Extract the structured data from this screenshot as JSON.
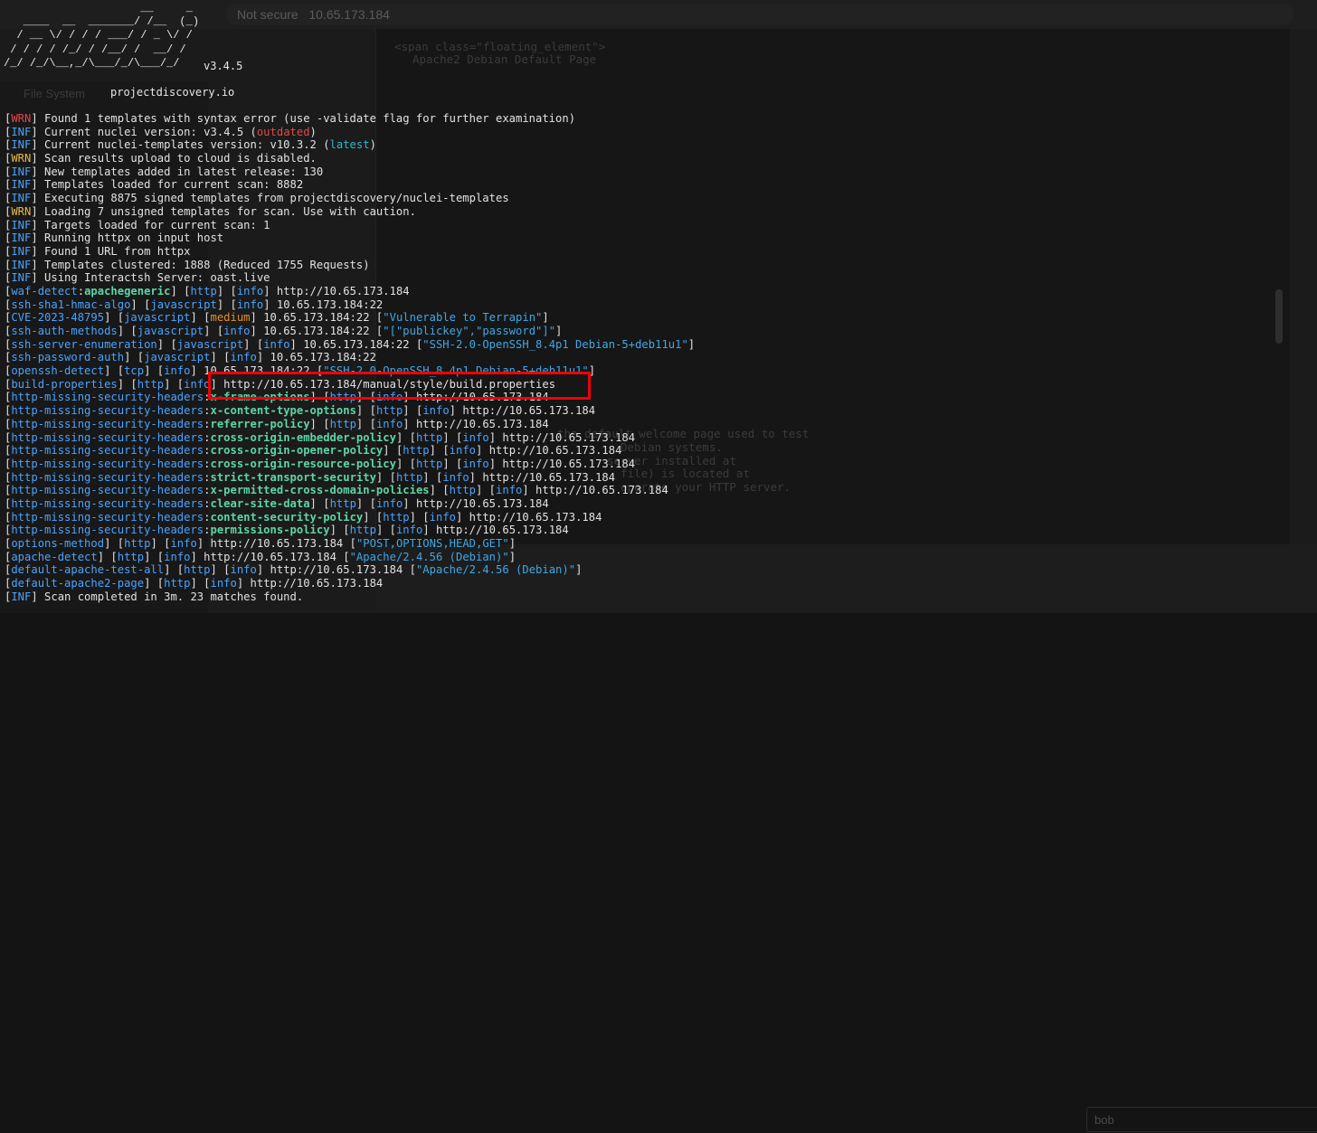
{
  "background": {
    "url_text": "Not secure",
    "url_host": "10.65.173.184",
    "left_label": "File System",
    "source_title": "Apache2 Debian Default Page",
    "field_value": "bob",
    "ghost_lines": [
      "<span class=\"floating_element\">",
      "Apache2 Debian Default Page",
      "the default welcome page used to test",
      "Debian systems.",
      "server installed at",
      "file) is located at",
      "operate your HTTP server."
    ]
  },
  "terminal": {
    "banner_art": "                     __     _\n   ____  __  _______/ /__  (_)\n  / __ \\/ / / / ___/ / _ \\/ /\n / / / / /_/ / /__/ /  __/ /\n/_/ /_/\\__,_/\\___/_/\\___/_/",
    "version": "v3.4.5",
    "site": "projectdiscovery.io",
    "colors": {
      "tag_wrn": "#e14848",
      "tag_wrn_alt": "#e8b84a",
      "tag_inf": "#4aa3ff",
      "matcher": "#5dd6a6",
      "medium": "#e28f2d",
      "string": "#3fa8e6",
      "highlight_box": "#f00008"
    },
    "lines": [
      [
        {
          "t": "[",
          "c": "wht"
        },
        {
          "t": "WRN",
          "c": "red"
        },
        {
          "t": "] Found 1 templates with syntax error (use -validate flag for further examination)",
          "c": "wht"
        }
      ],
      [
        {
          "t": "[",
          "c": "wht"
        },
        {
          "t": "INF",
          "c": "blu"
        },
        {
          "t": "] Current nuclei version: v3.4.5 (",
          "c": "wht"
        },
        {
          "t": "outdated",
          "c": "red"
        },
        {
          "t": ")",
          "c": "wht"
        }
      ],
      [
        {
          "t": "[",
          "c": "wht"
        },
        {
          "t": "INF",
          "c": "blu"
        },
        {
          "t": "] Current nuclei-templates version: v10.3.2 (",
          "c": "wht"
        },
        {
          "t": "latest",
          "c": "cyn"
        },
        {
          "t": ")",
          "c": "wht"
        }
      ],
      [
        {
          "t": "[",
          "c": "wht"
        },
        {
          "t": "WRN",
          "c": "ylw"
        },
        {
          "t": "] Scan results upload to cloud is disabled.",
          "c": "wht"
        }
      ],
      [
        {
          "t": "[",
          "c": "wht"
        },
        {
          "t": "INF",
          "c": "blu"
        },
        {
          "t": "] New templates added in latest release: 130",
          "c": "wht"
        }
      ],
      [
        {
          "t": "[",
          "c": "wht"
        },
        {
          "t": "INF",
          "c": "blu"
        },
        {
          "t": "] Templates loaded for current scan: 8882",
          "c": "wht"
        }
      ],
      [
        {
          "t": "[",
          "c": "wht"
        },
        {
          "t": "INF",
          "c": "blu"
        },
        {
          "t": "] Executing 8875 signed templates from projectdiscovery/nuclei-templates",
          "c": "wht"
        }
      ],
      [
        {
          "t": "[",
          "c": "wht"
        },
        {
          "t": "WRN",
          "c": "ylw"
        },
        {
          "t": "] Loading 7 unsigned templates for scan. Use with caution.",
          "c": "wht"
        }
      ],
      [
        {
          "t": "[",
          "c": "wht"
        },
        {
          "t": "INF",
          "c": "blu"
        },
        {
          "t": "] Targets loaded for current scan: 1",
          "c": "wht"
        }
      ],
      [
        {
          "t": "[",
          "c": "wht"
        },
        {
          "t": "INF",
          "c": "blu"
        },
        {
          "t": "] Running httpx on input host",
          "c": "wht"
        }
      ],
      [
        {
          "t": "[",
          "c": "wht"
        },
        {
          "t": "INF",
          "c": "blu"
        },
        {
          "t": "] Found 1 URL from httpx",
          "c": "wht"
        }
      ],
      [
        {
          "t": "[",
          "c": "wht"
        },
        {
          "t": "INF",
          "c": "blu"
        },
        {
          "t": "] Templates clustered: 1888 (Reduced 1755 Requests)",
          "c": "wht"
        }
      ],
      [
        {
          "t": "[",
          "c": "wht"
        },
        {
          "t": "INF",
          "c": "blu"
        },
        {
          "t": "] Using Interactsh Server: oast.live",
          "c": "wht"
        }
      ],
      [
        {
          "t": "[",
          "c": "wht"
        },
        {
          "t": "waf-detect",
          "c": "blu"
        },
        {
          "t": ":",
          "c": "wht"
        },
        {
          "t": "apachegeneric",
          "c": "grn"
        },
        {
          "t": "] [",
          "c": "wht"
        },
        {
          "t": "http",
          "c": "blu"
        },
        {
          "t": "] [",
          "c": "wht"
        },
        {
          "t": "info",
          "c": "blu"
        },
        {
          "t": "] http://10.65.173.184",
          "c": "wht"
        }
      ],
      [
        {
          "t": "[",
          "c": "wht"
        },
        {
          "t": "ssh-sha1-hmac-algo",
          "c": "blu"
        },
        {
          "t": "] [",
          "c": "wht"
        },
        {
          "t": "javascript",
          "c": "blu"
        },
        {
          "t": "] [",
          "c": "wht"
        },
        {
          "t": "info",
          "c": "blu"
        },
        {
          "t": "] 10.65.173.184:22",
          "c": "wht"
        }
      ],
      [
        {
          "t": "[",
          "c": "wht"
        },
        {
          "t": "CVE-2023-48795",
          "c": "blu"
        },
        {
          "t": "] [",
          "c": "wht"
        },
        {
          "t": "javascript",
          "c": "blu"
        },
        {
          "t": "] [",
          "c": "wht"
        },
        {
          "t": "medium",
          "c": "org"
        },
        {
          "t": "] 10.65.173.184:22 [",
          "c": "wht"
        },
        {
          "t": "\"Vulnerable to Terrapin\"",
          "c": "str"
        },
        {
          "t": "]",
          "c": "wht"
        }
      ],
      [
        {
          "t": "[",
          "c": "wht"
        },
        {
          "t": "ssh-auth-methods",
          "c": "blu"
        },
        {
          "t": "] [",
          "c": "wht"
        },
        {
          "t": "javascript",
          "c": "blu"
        },
        {
          "t": "] [",
          "c": "wht"
        },
        {
          "t": "info",
          "c": "blu"
        },
        {
          "t": "] 10.65.173.184:22 [",
          "c": "wht"
        },
        {
          "t": "\"[\"publickey\",\"password\"]\"",
          "c": "str"
        },
        {
          "t": "]",
          "c": "wht"
        }
      ],
      [
        {
          "t": "[",
          "c": "wht"
        },
        {
          "t": "ssh-server-enumeration",
          "c": "blu"
        },
        {
          "t": "] [",
          "c": "wht"
        },
        {
          "t": "javascript",
          "c": "blu"
        },
        {
          "t": "] [",
          "c": "wht"
        },
        {
          "t": "info",
          "c": "blu"
        },
        {
          "t": "] 10.65.173.184:22 [",
          "c": "wht"
        },
        {
          "t": "\"SSH-2.0-OpenSSH_8.4p1 Debian-5+deb11u1\"",
          "c": "str"
        },
        {
          "t": "]",
          "c": "wht"
        }
      ],
      [
        {
          "t": "[",
          "c": "wht"
        },
        {
          "t": "ssh-password-auth",
          "c": "blu"
        },
        {
          "t": "] [",
          "c": "wht"
        },
        {
          "t": "javascript",
          "c": "blu"
        },
        {
          "t": "] [",
          "c": "wht"
        },
        {
          "t": "info",
          "c": "blu"
        },
        {
          "t": "] 10.65.173.184:22",
          "c": "wht"
        }
      ],
      [
        {
          "t": "[",
          "c": "wht"
        },
        {
          "t": "openssh-detect",
          "c": "blu"
        },
        {
          "t": "] [",
          "c": "wht"
        },
        {
          "t": "tcp",
          "c": "blu"
        },
        {
          "t": "] [",
          "c": "wht"
        },
        {
          "t": "info",
          "c": "blu"
        },
        {
          "t": "] 10.65.173.184:22 [",
          "c": "wht"
        },
        {
          "t": "\"SSH-2.0-OpenSSH_8.4p1 Debian-5+deb11u1\"",
          "c": "str"
        },
        {
          "t": "]",
          "c": "wht"
        }
      ],
      [
        {
          "t": "[",
          "c": "wht"
        },
        {
          "t": "build-properties",
          "c": "blu"
        },
        {
          "t": "] [",
          "c": "wht"
        },
        {
          "t": "http",
          "c": "blu"
        },
        {
          "t": "] [",
          "c": "wht"
        },
        {
          "t": "info",
          "c": "blu"
        },
        {
          "t": "] http://10.65.173.184/manual/style/build.properties",
          "c": "wht"
        }
      ],
      [
        {
          "t": "[",
          "c": "wht"
        },
        {
          "t": "http-missing-security-headers",
          "c": "blu"
        },
        {
          "t": ":",
          "c": "wht"
        },
        {
          "t": "x-frame-options",
          "c": "grn"
        },
        {
          "t": "] [",
          "c": "wht"
        },
        {
          "t": "http",
          "c": "blu"
        },
        {
          "t": "] [",
          "c": "wht"
        },
        {
          "t": "info",
          "c": "blu"
        },
        {
          "t": "] http://10.65.173.184",
          "c": "wht"
        }
      ],
      [
        {
          "t": "[",
          "c": "wht"
        },
        {
          "t": "http-missing-security-headers",
          "c": "blu"
        },
        {
          "t": ":",
          "c": "wht"
        },
        {
          "t": "x-content-type-options",
          "c": "grn"
        },
        {
          "t": "] [",
          "c": "wht"
        },
        {
          "t": "http",
          "c": "blu"
        },
        {
          "t": "] [",
          "c": "wht"
        },
        {
          "t": "info",
          "c": "blu"
        },
        {
          "t": "] http://10.65.173.184",
          "c": "wht"
        }
      ],
      [
        {
          "t": "[",
          "c": "wht"
        },
        {
          "t": "http-missing-security-headers",
          "c": "blu"
        },
        {
          "t": ":",
          "c": "wht"
        },
        {
          "t": "referrer-policy",
          "c": "grn"
        },
        {
          "t": "] [",
          "c": "wht"
        },
        {
          "t": "http",
          "c": "blu"
        },
        {
          "t": "] [",
          "c": "wht"
        },
        {
          "t": "info",
          "c": "blu"
        },
        {
          "t": "] http://10.65.173.184",
          "c": "wht"
        }
      ],
      [
        {
          "t": "[",
          "c": "wht"
        },
        {
          "t": "http-missing-security-headers",
          "c": "blu"
        },
        {
          "t": ":",
          "c": "wht"
        },
        {
          "t": "cross-origin-embedder-policy",
          "c": "grn"
        },
        {
          "t": "] [",
          "c": "wht"
        },
        {
          "t": "http",
          "c": "blu"
        },
        {
          "t": "] [",
          "c": "wht"
        },
        {
          "t": "info",
          "c": "blu"
        },
        {
          "t": "] http://10.65.173.184",
          "c": "wht"
        }
      ],
      [
        {
          "t": "[",
          "c": "wht"
        },
        {
          "t": "http-missing-security-headers",
          "c": "blu"
        },
        {
          "t": ":",
          "c": "wht"
        },
        {
          "t": "cross-origin-opener-policy",
          "c": "grn"
        },
        {
          "t": "] [",
          "c": "wht"
        },
        {
          "t": "http",
          "c": "blu"
        },
        {
          "t": "] [",
          "c": "wht"
        },
        {
          "t": "info",
          "c": "blu"
        },
        {
          "t": "] http://10.65.173.184",
          "c": "wht"
        }
      ],
      [
        {
          "t": "[",
          "c": "wht"
        },
        {
          "t": "http-missing-security-headers",
          "c": "blu"
        },
        {
          "t": ":",
          "c": "wht"
        },
        {
          "t": "cross-origin-resource-policy",
          "c": "grn"
        },
        {
          "t": "] [",
          "c": "wht"
        },
        {
          "t": "http",
          "c": "blu"
        },
        {
          "t": "] [",
          "c": "wht"
        },
        {
          "t": "info",
          "c": "blu"
        },
        {
          "t": "] http://10.65.173.184",
          "c": "wht"
        }
      ],
      [
        {
          "t": "[",
          "c": "wht"
        },
        {
          "t": "http-missing-security-headers",
          "c": "blu"
        },
        {
          "t": ":",
          "c": "wht"
        },
        {
          "t": "strict-transport-security",
          "c": "grn"
        },
        {
          "t": "] [",
          "c": "wht"
        },
        {
          "t": "http",
          "c": "blu"
        },
        {
          "t": "] [",
          "c": "wht"
        },
        {
          "t": "info",
          "c": "blu"
        },
        {
          "t": "] http://10.65.173.184",
          "c": "wht"
        }
      ],
      [
        {
          "t": "[",
          "c": "wht"
        },
        {
          "t": "http-missing-security-headers",
          "c": "blu"
        },
        {
          "t": ":",
          "c": "wht"
        },
        {
          "t": "x-permitted-cross-domain-policies",
          "c": "grn"
        },
        {
          "t": "] [",
          "c": "wht"
        },
        {
          "t": "http",
          "c": "blu"
        },
        {
          "t": "] [",
          "c": "wht"
        },
        {
          "t": "info",
          "c": "blu"
        },
        {
          "t": "] http://10.65.173.184",
          "c": "wht"
        }
      ],
      [
        {
          "t": "[",
          "c": "wht"
        },
        {
          "t": "http-missing-security-headers",
          "c": "blu"
        },
        {
          "t": ":",
          "c": "wht"
        },
        {
          "t": "clear-site-data",
          "c": "grn"
        },
        {
          "t": "] [",
          "c": "wht"
        },
        {
          "t": "http",
          "c": "blu"
        },
        {
          "t": "] [",
          "c": "wht"
        },
        {
          "t": "info",
          "c": "blu"
        },
        {
          "t": "] http://10.65.173.184",
          "c": "wht"
        }
      ],
      [
        {
          "t": "[",
          "c": "wht"
        },
        {
          "t": "http-missing-security-headers",
          "c": "blu"
        },
        {
          "t": ":",
          "c": "wht"
        },
        {
          "t": "content-security-policy",
          "c": "grn"
        },
        {
          "t": "] [",
          "c": "wht"
        },
        {
          "t": "http",
          "c": "blu"
        },
        {
          "t": "] [",
          "c": "wht"
        },
        {
          "t": "info",
          "c": "blu"
        },
        {
          "t": "] http://10.65.173.184",
          "c": "wht"
        }
      ],
      [
        {
          "t": "[",
          "c": "wht"
        },
        {
          "t": "http-missing-security-headers",
          "c": "blu"
        },
        {
          "t": ":",
          "c": "wht"
        },
        {
          "t": "permissions-policy",
          "c": "grn"
        },
        {
          "t": "] [",
          "c": "wht"
        },
        {
          "t": "http",
          "c": "blu"
        },
        {
          "t": "] [",
          "c": "wht"
        },
        {
          "t": "info",
          "c": "blu"
        },
        {
          "t": "] http://10.65.173.184",
          "c": "wht"
        }
      ],
      [
        {
          "t": "[",
          "c": "wht"
        },
        {
          "t": "options-method",
          "c": "blu"
        },
        {
          "t": "] [",
          "c": "wht"
        },
        {
          "t": "http",
          "c": "blu"
        },
        {
          "t": "] [",
          "c": "wht"
        },
        {
          "t": "info",
          "c": "blu"
        },
        {
          "t": "] http://10.65.173.184 [",
          "c": "wht"
        },
        {
          "t": "\"POST,OPTIONS,HEAD,GET\"",
          "c": "str"
        },
        {
          "t": "]",
          "c": "wht"
        }
      ],
      [
        {
          "t": "[",
          "c": "wht"
        },
        {
          "t": "apache-detect",
          "c": "blu"
        },
        {
          "t": "] [",
          "c": "wht"
        },
        {
          "t": "http",
          "c": "blu"
        },
        {
          "t": "] [",
          "c": "wht"
        },
        {
          "t": "info",
          "c": "blu"
        },
        {
          "t": "] http://10.65.173.184 [",
          "c": "wht"
        },
        {
          "t": "\"Apache/2.4.56 (Debian)\"",
          "c": "str"
        },
        {
          "t": "]",
          "c": "wht"
        }
      ],
      [
        {
          "t": "[",
          "c": "wht"
        },
        {
          "t": "default-apache-test-all",
          "c": "blu"
        },
        {
          "t": "] [",
          "c": "wht"
        },
        {
          "t": "http",
          "c": "blu"
        },
        {
          "t": "] [",
          "c": "wht"
        },
        {
          "t": "info",
          "c": "blu"
        },
        {
          "t": "] http://10.65.173.184 [",
          "c": "wht"
        },
        {
          "t": "\"Apache/2.4.56 (Debian)\"",
          "c": "str"
        },
        {
          "t": "]",
          "c": "wht"
        }
      ],
      [
        {
          "t": "[",
          "c": "wht"
        },
        {
          "t": "default-apache2-page",
          "c": "blu"
        },
        {
          "t": "] [",
          "c": "wht"
        },
        {
          "t": "http",
          "c": "blu"
        },
        {
          "t": "] [",
          "c": "wht"
        },
        {
          "t": "info",
          "c": "blu"
        },
        {
          "t": "] http://10.65.173.184",
          "c": "wht"
        }
      ],
      [
        {
          "t": "[",
          "c": "wht"
        },
        {
          "t": "INF",
          "c": "blu"
        },
        {
          "t": "] Scan completed in 3m. 23 matches found.",
          "c": "wht"
        }
      ]
    ]
  }
}
